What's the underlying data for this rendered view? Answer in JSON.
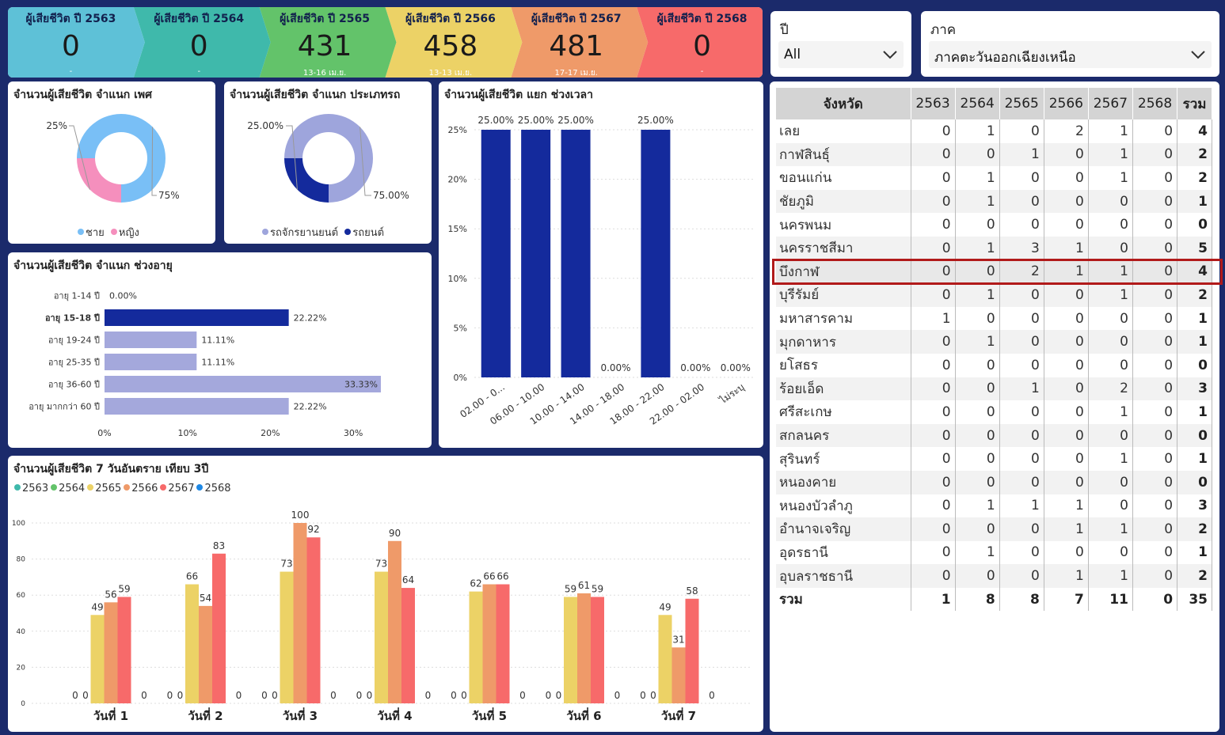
{
  "kpi": [
    {
      "title": "ผู้เสียชีวิต ปี 2563",
      "value": "0",
      "sub": "-",
      "color": "#5ec1d7"
    },
    {
      "title": "ผู้เสียชีวิต ปี 2564",
      "value": "0",
      "sub": "-",
      "color": "#3fb9ab"
    },
    {
      "title": "ผู้เสียชีวิต ปี 2565",
      "value": "431",
      "sub": "13-16 เม.ย.",
      "color": "#63c36a"
    },
    {
      "title": "ผู้เสียชีวิต ปี 2566",
      "value": "458",
      "sub": "13-13 เม.ย.",
      "color": "#ecd266"
    },
    {
      "title": "ผู้เสียชีวิต ปี 2567",
      "value": "481",
      "sub": "17-17 เม.ย.",
      "color": "#ef9a69"
    },
    {
      "title": "ผู้เสียชีวิต ปี 2568",
      "value": "0",
      "sub": "-",
      "color": "#f76a6a"
    }
  ],
  "filters": {
    "year": {
      "label": "ปี",
      "value": "All"
    },
    "region": {
      "label": "ภาค",
      "value": "ภาคตะวันออกเฉียงเหนือ"
    }
  },
  "gender_chart": {
    "title": "จำนวนผู้เสียชีวิต จำแนก เพศ",
    "legend": [
      {
        "name": "ชาย",
        "color": "#79bff6"
      },
      {
        "name": "หญิง",
        "color": "#f58fbd"
      }
    ],
    "chart_data": {
      "type": "pie",
      "labels": [
        "ชาย",
        "หญิง"
      ],
      "values": [
        75,
        25
      ],
      "value_labels": [
        "75%",
        "25%"
      ]
    }
  },
  "vehicle_chart": {
    "title": "จำนวนผู้เสียชีวิต จำแนก ประเภทรถ",
    "legend": [
      {
        "name": "รถจักรยานยนต์",
        "color": "#9ea5dc"
      },
      {
        "name": "รถยนต์",
        "color": "#142a9c"
      }
    ],
    "chart_data": {
      "type": "pie",
      "labels": [
        "รถจักรยานยนต์",
        "รถยนต์"
      ],
      "values": [
        75,
        25
      ],
      "value_labels": [
        "75.00%",
        "25.00%"
      ]
    }
  },
  "age_chart": {
    "title": "จำนวนผู้เสียชีวิต จำแนก ช่วงอายุ",
    "chart_data": {
      "type": "bar",
      "orientation": "horizontal",
      "categories": [
        "อายุ 1-14 ปี",
        "อายุ 15-18 ปี",
        "อายุ 19-24 ปี",
        "อายุ 25-35 ปี",
        "อายุ 36-60 ปี",
        "อายุ มากกว่า 60 ปี"
      ],
      "values": [
        0,
        22.22,
        11.11,
        11.11,
        33.33,
        22.22
      ],
      "value_labels": [
        "0.00%",
        "22.22%",
        "11.11%",
        "11.11%",
        "33.33%",
        "22.22%"
      ],
      "highlight_index": 1,
      "xlim": [
        0,
        33.33
      ],
      "xticks": [
        "0%",
        "10%",
        "20%",
        "30%"
      ],
      "colors": {
        "normal": "#a4a8dc",
        "highlight": "#142a9c"
      }
    }
  },
  "time_chart": {
    "title": "จำนวนผู้เสียชีวิต แยก ช่วงเวลา",
    "chart_data": {
      "type": "bar",
      "categories": [
        "02.00 - 0...",
        "06.00 - 10.00",
        "10.00 - 14.00",
        "14.00 - 18.00",
        "18.00 - 22.00",
        "22.00 - 02.00",
        "ไม่ระบุ"
      ],
      "values": [
        25,
        25,
        25,
        0,
        25,
        0,
        0
      ],
      "value_labels": [
        "25.00%",
        "25.00%",
        "25.00%",
        "0.00%",
        "25.00%",
        "0.00%",
        "0.00%"
      ],
      "ylim": [
        0,
        25
      ],
      "yticks": [
        "0%",
        "5%",
        "10%",
        "15%",
        "20%",
        "25%"
      ],
      "color": "#142a9c"
    }
  },
  "days_chart": {
    "title": "จำนวนผู้เสียชีวิต 7 วันอันตราย เทียบ 3ปี",
    "chart_data": {
      "type": "bar",
      "categories": [
        "วันที่ 1",
        "วันที่ 2",
        "วันที่ 3",
        "วันที่ 4",
        "วันที่ 5",
        "วันที่ 6",
        "วันที่ 7"
      ],
      "series": [
        {
          "name": "2563",
          "color": "#3fb9ab",
          "values": [
            0,
            0,
            0,
            0,
            0,
            0,
            0
          ]
        },
        {
          "name": "2564",
          "color": "#63c36a",
          "values": [
            0,
            0,
            0,
            0,
            0,
            0,
            0
          ]
        },
        {
          "name": "2565",
          "color": "#ecd266",
          "values": [
            49,
            66,
            73,
            73,
            62,
            59,
            49
          ]
        },
        {
          "name": "2566",
          "color": "#ef9a69",
          "values": [
            56,
            54,
            100,
            90,
            66,
            61,
            31
          ]
        },
        {
          "name": "2567",
          "color": "#f76a6a",
          "values": [
            59,
            83,
            92,
            64,
            66,
            59,
            58
          ]
        },
        {
          "name": "2568",
          "color": "#1e88e5",
          "values": [
            0,
            0,
            0,
            0,
            0,
            0,
            0
          ]
        }
      ],
      "ylim": [
        0,
        100
      ],
      "yticks": [
        "0",
        "20",
        "40",
        "60",
        "80",
        "100"
      ]
    }
  },
  "table": {
    "headers": [
      "จังหวัด",
      "2563",
      "2564",
      "2565",
      "2566",
      "2567",
      "2568",
      "รวม"
    ],
    "selected_row": 6,
    "rows": [
      [
        "เลย",
        "0",
        "1",
        "0",
        "2",
        "1",
        "0",
        "4"
      ],
      [
        "กาฬสินธุ์",
        "0",
        "0",
        "1",
        "0",
        "1",
        "0",
        "2"
      ],
      [
        "ขอนแก่น",
        "0",
        "1",
        "0",
        "0",
        "1",
        "0",
        "2"
      ],
      [
        "ชัยภูมิ",
        "0",
        "1",
        "0",
        "0",
        "0",
        "0",
        "1"
      ],
      [
        "นครพนม",
        "0",
        "0",
        "0",
        "0",
        "0",
        "0",
        "0"
      ],
      [
        "นครราชสีมา",
        "0",
        "1",
        "3",
        "1",
        "0",
        "0",
        "5"
      ],
      [
        "บึงกาฬ",
        "0",
        "0",
        "2",
        "1",
        "1",
        "0",
        "4"
      ],
      [
        "บุรีรัมย์",
        "0",
        "1",
        "0",
        "0",
        "1",
        "0",
        "2"
      ],
      [
        "มหาสารคาม",
        "1",
        "0",
        "0",
        "0",
        "0",
        "0",
        "1"
      ],
      [
        "มุกดาหาร",
        "0",
        "1",
        "0",
        "0",
        "0",
        "0",
        "1"
      ],
      [
        "ยโสธร",
        "0",
        "0",
        "0",
        "0",
        "0",
        "0",
        "0"
      ],
      [
        "ร้อยเอ็ด",
        "0",
        "0",
        "1",
        "0",
        "2",
        "0",
        "3"
      ],
      [
        "ศรีสะเกษ",
        "0",
        "0",
        "0",
        "0",
        "1",
        "0",
        "1"
      ],
      [
        "สกลนคร",
        "0",
        "0",
        "0",
        "0",
        "0",
        "0",
        "0"
      ],
      [
        "สุรินทร์",
        "0",
        "0",
        "0",
        "0",
        "1",
        "0",
        "1"
      ],
      [
        "หนองคาย",
        "0",
        "0",
        "0",
        "0",
        "0",
        "0",
        "0"
      ],
      [
        "หนองบัวลำภู",
        "0",
        "1",
        "1",
        "1",
        "0",
        "0",
        "3"
      ],
      [
        "อำนาจเจริญ",
        "0",
        "0",
        "0",
        "1",
        "1",
        "0",
        "2"
      ],
      [
        "อุดรธานี",
        "0",
        "1",
        "0",
        "0",
        "0",
        "0",
        "1"
      ],
      [
        "อุบลราชธานี",
        "0",
        "0",
        "0",
        "1",
        "1",
        "0",
        "2"
      ]
    ],
    "total_row": [
      "รวม",
      "1",
      "8",
      "8",
      "7",
      "11",
      "0",
      "35"
    ]
  }
}
